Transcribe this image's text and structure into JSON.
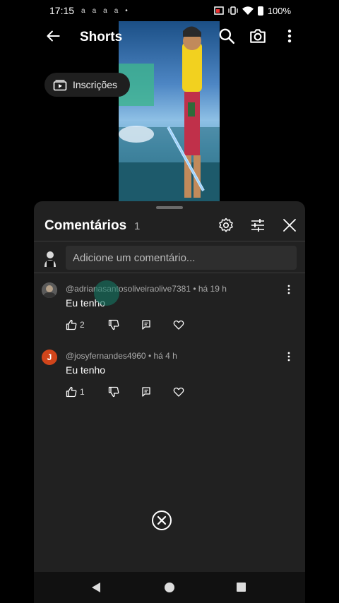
{
  "status_bar": {
    "time": "17:15",
    "notification_icons": [
      "a",
      "a",
      "a",
      "a",
      "•"
    ],
    "battery": "100%"
  },
  "top_bar": {
    "title": "Shorts",
    "icons": [
      "back-arrow-icon",
      "search-icon",
      "camera-icon",
      "more-vert-icon"
    ]
  },
  "chip": {
    "label": "Inscrições",
    "icon": "subscriptions-icon"
  },
  "comments_sheet": {
    "title": "Comentários",
    "count": "1",
    "input_placeholder": "Adicione um comentário...",
    "comments": [
      {
        "author": "@adrianasantosoliveiraolive7381",
        "time": "há 19 h",
        "text": "Eu tenho",
        "likes": "2",
        "avatar_color": "#6b6b6b",
        "avatar_letter": ""
      },
      {
        "author": "@josyfernandes4960",
        "time": "há 4 h",
        "text": "Eu tenho",
        "likes": "1",
        "avatar_color": "#d1451b",
        "avatar_letter": "J"
      }
    ]
  },
  "colors": {
    "sheet_bg": "#212121",
    "input_bg": "#2e2e2e",
    "muted_text": "#aaaaaa"
  }
}
